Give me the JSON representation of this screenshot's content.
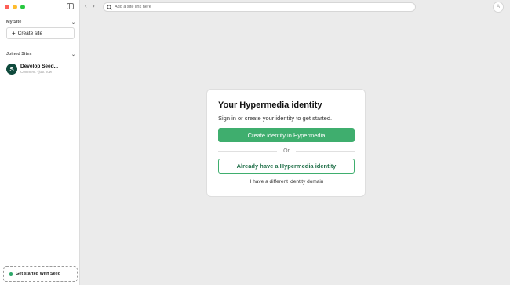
{
  "sidebar": {
    "my_site": {
      "title": "My Site",
      "create_label": "Create site"
    },
    "joined_sites": {
      "title": "Joined Sites",
      "items": [
        {
          "name": "Develop Seed...",
          "subtitle": "Comment · just now",
          "avatar_letter": "S"
        }
      ]
    },
    "get_started_label": "Get started With Seed"
  },
  "toolbar": {
    "url_placeholder": "Add a site link here",
    "back_glyph": "‹",
    "forward_glyph": "›",
    "avatar_letter": "A"
  },
  "identity_card": {
    "title": "Your Hypermedia identity",
    "subtitle": "Sign in or create your identity to get started.",
    "create_button": "Create identity in Hypermedia",
    "divider_text": "Or",
    "existing_button": "Already have a Hypermedia identity",
    "domain_link": "I have a different identity domain"
  },
  "colors": {
    "accent": "#3fae6e",
    "accent_dark": "#1f6f48",
    "site_avatar": "#0f4a3c"
  },
  "icons": [
    "sidebar-toggle-icon",
    "search-icon",
    "chevron-down-icon",
    "plus-icon",
    "back-arrow-icon",
    "forward-arrow-icon"
  ]
}
